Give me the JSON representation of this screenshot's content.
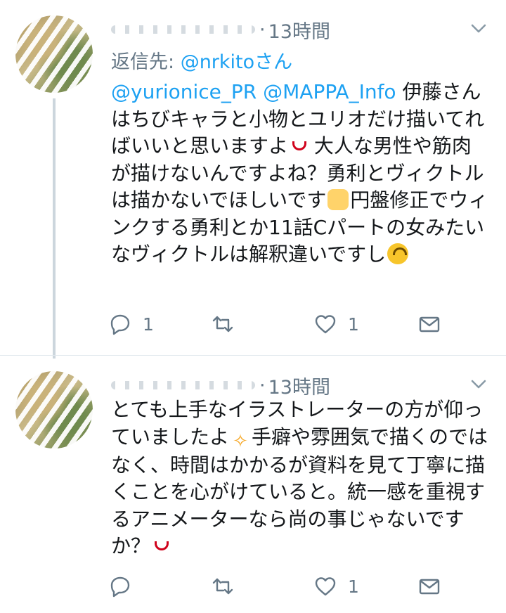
{
  "tweets": [
    {
      "time": "13時間",
      "reply_label": "返信先: ",
      "reply_user": "@nrkitoさん",
      "mentions": "@yurionice_PR @MAPPA_Info",
      "text_a": " 伊藤さんはちびキャラと小物とユリオだけ描いてればいいと思いますよ",
      "text_b": " 大人な男性や筋肉が描けないんですよね？勇利とヴィクトルは描かないでほしいです",
      "text_c": "円盤修正でウィンクする勇利とか11話Cパートの女みたいなヴィクトルは解釈違いですし",
      "replies": "1",
      "retweets": "",
      "likes": "1",
      "emoji_1": "tongue-emoji",
      "emoji_2": "raised-hands-emoji",
      "emoji_3": "upside-down-face-emoji"
    },
    {
      "time": "13時間",
      "text_a": "とても上手なイラストレーターの方が仰っていましたよ",
      "text_b": "手癖や雰囲気で描くのではなく、時間はかかるが資料を見て丁寧に描くことを心がけていると。統一感を重視するアニメーターなら尚の事じゃないですか？",
      "replies": "",
      "retweets": "",
      "likes": "1",
      "emoji_1": "sparkles-emoji",
      "emoji_2": "tongue-emoji"
    }
  ],
  "colors": {
    "link": "#1da1f2",
    "secondary": "#657786",
    "text": "#14171a",
    "divider": "#e1e8ed",
    "thread_line": "#ccd6dd"
  }
}
